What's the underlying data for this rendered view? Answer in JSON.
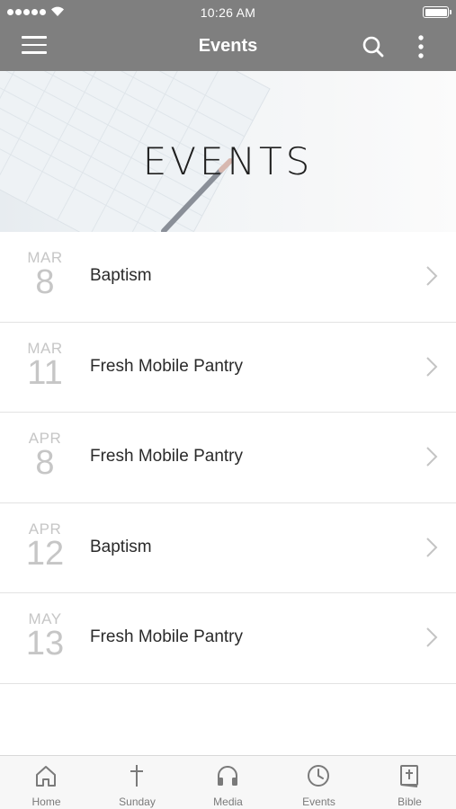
{
  "status_bar": {
    "time": "10:26 AM"
  },
  "nav": {
    "title": "Events",
    "icons": [
      "hamburger-menu-icon",
      "search-icon",
      "more-vertical-icon"
    ]
  },
  "banner": {
    "title": "EVENTS",
    "image": "yearly-planner-photo"
  },
  "events": [
    {
      "month": "MAR",
      "day": "8",
      "title": "Baptism"
    },
    {
      "month": "MAR",
      "day": "11",
      "title": "Fresh Mobile Pantry"
    },
    {
      "month": "APR",
      "day": "8",
      "title": "Fresh Mobile Pantry"
    },
    {
      "month": "APR",
      "day": "12",
      "title": "Baptism"
    },
    {
      "month": "MAY",
      "day": "13",
      "title": "Fresh Mobile Pantry"
    }
  ],
  "tabs": [
    {
      "label": "Home",
      "icon": "home-icon"
    },
    {
      "label": "Sunday",
      "icon": "cross-icon"
    },
    {
      "label": "Media",
      "icon": "headphones-icon"
    },
    {
      "label": "Events",
      "icon": "clock-icon"
    },
    {
      "label": "Bible",
      "icon": "bible-icon"
    }
  ],
  "colors": {
    "header": "#7f7f7f",
    "date_text": "#c6c6c6",
    "tab_icon": "#7a7a7a",
    "divider": "#e3e3e3"
  }
}
